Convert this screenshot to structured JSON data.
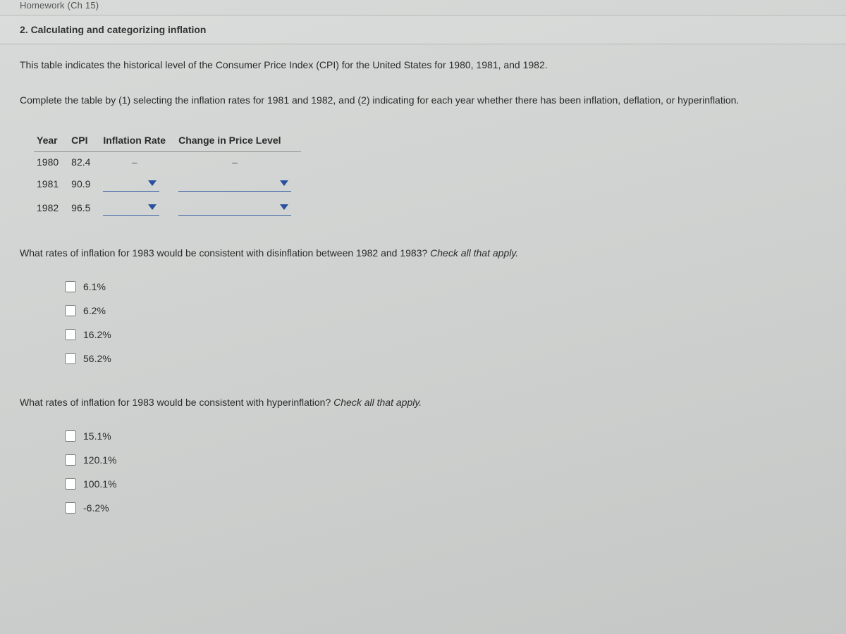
{
  "breadcrumb_partial": "Homework (Ch 15)",
  "section_title": "2. Calculating and categorizing inflation",
  "intro1": "This table indicates the historical level of the Consumer Price Index (CPI) for the United States for 1980, 1981, and 1982.",
  "intro2": "Complete the table by (1) selecting the inflation rates for 1981 and 1982, and (2) indicating for each year whether there has been inflation, deflation, or hyperinflation.",
  "table": {
    "headers": {
      "year": "Year",
      "cpi": "CPI",
      "rate": "Inflation Rate",
      "change": "Change in Price Level"
    },
    "rows": [
      {
        "year": "1980",
        "cpi": "82.4",
        "rate": "–",
        "change": "–",
        "has_dropdowns": false
      },
      {
        "year": "1981",
        "cpi": "90.9",
        "rate": "",
        "change": "",
        "has_dropdowns": true
      },
      {
        "year": "1982",
        "cpi": "96.5",
        "rate": "",
        "change": "",
        "has_dropdowns": true
      }
    ]
  },
  "q1": {
    "text": "What rates of inflation for 1983 would be consistent with disinflation between 1982 and 1983? ",
    "hint": "Check all that apply.",
    "options": [
      "6.1%",
      "6.2%",
      "16.2%",
      "56.2%"
    ]
  },
  "q2": {
    "text": "What rates of inflation for 1983 would be consistent with hyperinflation? ",
    "hint": "Check all that apply.",
    "options": [
      "15.1%",
      "120.1%",
      "100.1%",
      "-6.2%"
    ]
  }
}
